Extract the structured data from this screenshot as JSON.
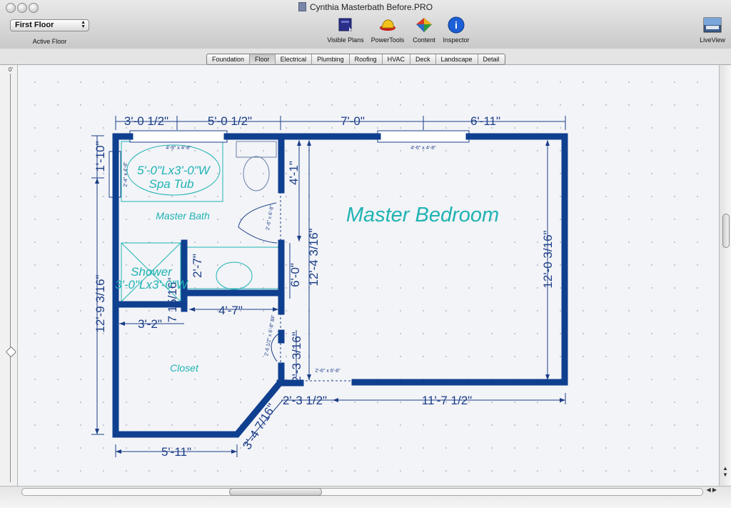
{
  "window": {
    "title": "Cynthia Masterbath Before.PRO"
  },
  "toolbar": {
    "floor_select_value": "First Floor",
    "floor_caption": "Active Floor",
    "visible_plans": "Visible Plans",
    "powertools": "PowerTools",
    "content": "Content",
    "inspector": "Inspector",
    "liveview": "LiveView"
  },
  "tabs": [
    "Foundation",
    "Floor",
    "Electrical",
    "Plumbing",
    "Roofing",
    "HVAC",
    "Deck",
    "Landscape",
    "Detail"
  ],
  "active_tab": "Floor",
  "ruler": {
    "zero": "0'"
  },
  "colors": {
    "wall": "#0f3f8f",
    "dimension": "#1b3e87",
    "fixture": "#1fb3b3",
    "canvas": "#f3f4f8"
  },
  "plan": {
    "dims": {
      "top1": "3'-0 1/2\"",
      "top2": "5'-0 1/2\"",
      "top3": "7'-0\"",
      "top4": "6'-11\"",
      "left_top": "1'-10\"",
      "left_total": "12'-9 3/16\"",
      "wall_upper": "4'-1\"",
      "shower_w": "2'-7\"",
      "mid_vert": "6'-0\"",
      "long_vert": "12'-4 3/16\"",
      "right_vert": "12'-0 3/16\"",
      "bath_h": "4'-7\"",
      "shower_h": "7 15/16\"",
      "closet_left": "3'-2\"",
      "closet_door": "2'-3 3/16\"",
      "bottom_small": "2'-3 1/2\"",
      "bottom_right": "11'-7 1/2\"",
      "angled": "3'-4 7/16\"",
      "bottom_left": "5'-11\""
    },
    "labels": {
      "master_bedroom": "Master Bedroom",
      "master_bath": "Master Bath",
      "closet": "Closet",
      "spa_tub_1": "5'-0\"Lx3'-0\"W",
      "spa_tub_2": "Spa Tub",
      "shower_1": "Shower",
      "shower_2": "3'-0\"Lx3'-0\"W"
    },
    "windows": {
      "win1": "4'-9\" x 4'-8\"",
      "win2": "4'-6\" x 4'-8\"",
      "win3": "2'-4\" x 4'-8\""
    },
    "doors": {
      "door1": "2'-6\" x 6'-8\"",
      "door2": "2'-6 1/2\" x 6'-8\" BF",
      "door3": "2'-6\" x 6'-8\""
    }
  }
}
